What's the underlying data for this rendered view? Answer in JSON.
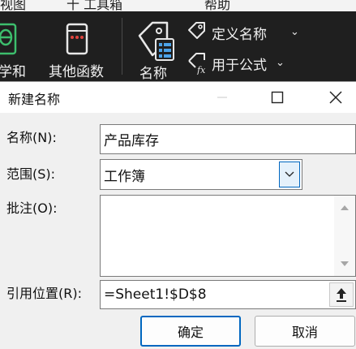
{
  "ribbon": {
    "top_fragment_left": "视图",
    "top_fragment_mid": "十 工具箱",
    "top_fragment_right": "帮助",
    "group_left_label": "学和",
    "group_other_label": "其他函数",
    "group_name_label": "名称",
    "define_name_label": "定义名称",
    "use_in_formula_label": "用于公式",
    "icons": [
      "math-icon",
      "other-functions-icon",
      "name-manager-icon",
      "define-name-tag-icon",
      "use-in-formula-icon"
    ]
  },
  "dialog": {
    "title": "新建名称",
    "name_label": "名称(N):",
    "name_value": "产品库存",
    "scope_label": "范围(S):",
    "scope_value": "工作簿",
    "comment_label": "批注(O):",
    "comment_value": "",
    "refers_to_label": "引用位置(R):",
    "refers_to_value": "=Sheet1!$D$8",
    "ok_label": "确定",
    "cancel_label": "取消"
  },
  "colors": {
    "ribbon_bg": "#1f1f1f",
    "dialog_bg": "#f0f0f0",
    "accent": "#0067c0",
    "green_icon": "#3dbe6d"
  }
}
